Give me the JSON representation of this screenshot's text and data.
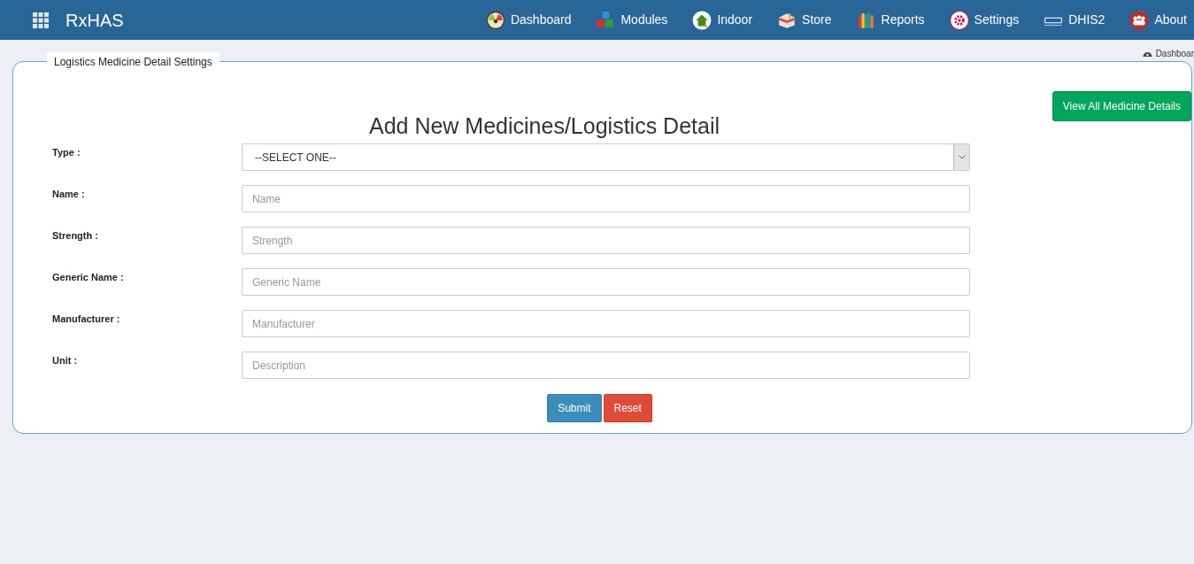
{
  "brand": "RxHAS",
  "nav": [
    {
      "label": "Dashboard"
    },
    {
      "label": "Modules"
    },
    {
      "label": "Indoor"
    },
    {
      "label": "Store"
    },
    {
      "label": "Reports"
    },
    {
      "label": "Settings"
    },
    {
      "label": "DHIS2"
    },
    {
      "label": "About"
    }
  ],
  "breadcrumb": "Dashboar",
  "panel": {
    "legend": "Logistics Medicine Detail Settings",
    "heading": "Add New Medicines/Logistics Detail",
    "view_all_button": "View All Medicine Details",
    "fields": [
      {
        "label": "Type :",
        "kind": "select",
        "value": "--SELECT ONE--"
      },
      {
        "label": "Name :",
        "kind": "text",
        "placeholder": "Name"
      },
      {
        "label": "Strength :",
        "kind": "text",
        "placeholder": "Strength"
      },
      {
        "label": "Generic Name :",
        "kind": "text",
        "placeholder": "Generic Name"
      },
      {
        "label": "Manufacturer :",
        "kind": "text",
        "placeholder": "Manufacturer"
      },
      {
        "label": "Unit :",
        "kind": "text",
        "placeholder": "Description"
      }
    ],
    "buttons": [
      {
        "label": "Submit",
        "kind": "submit"
      },
      {
        "label": "Reset",
        "kind": "reset"
      }
    ]
  }
}
